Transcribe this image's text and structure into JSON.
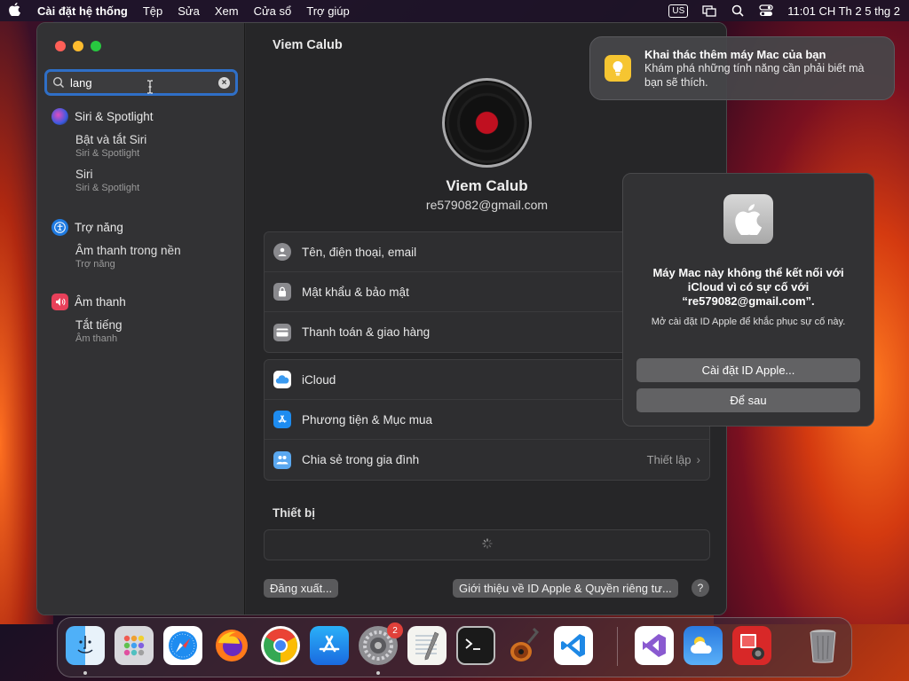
{
  "menubar": {
    "app_name": "Cài đặt hệ thống",
    "items": [
      "Tệp",
      "Sửa",
      "Xem",
      "Cửa sổ",
      "Trợ giúp"
    ],
    "input_source": "US",
    "clock": "11:01 CH Th 2 5 thg 2"
  },
  "sidebar": {
    "search_value": "lang",
    "groups": [
      {
        "title": "Siri & Spotlight",
        "subs": [
          {
            "t": "Bật và tắt Siri",
            "s": "Siri & Spotlight"
          },
          {
            "t": "Siri",
            "s": "Siri & Spotlight"
          }
        ]
      },
      {
        "title": "Trợ năng",
        "subs": [
          {
            "t": "Âm thanh trong nền",
            "s": "Trợ năng"
          }
        ]
      },
      {
        "title": "Âm thanh",
        "subs": [
          {
            "t": "Tắt tiếng",
            "s": "Âm thanh"
          }
        ]
      }
    ]
  },
  "content": {
    "title": "Viem Calub",
    "username": "Viem Calub",
    "email": "re579082@gmail.com",
    "group1": [
      "Tên, điện thoại, email",
      "Mật khẩu & bảo mật",
      "Thanh toán & giao hàng"
    ],
    "group2": [
      {
        "label": "iCloud",
        "right": ""
      },
      {
        "label": "Phương tiện & Mục mua",
        "right": ""
      },
      {
        "label": "Chia sẻ trong gia đình",
        "right": "Thiết lập"
      }
    ],
    "devices_title": "Thiết bị",
    "signout": "Đăng xuất...",
    "about": "Giới thiệu về ID Apple & Quyền riêng tư...",
    "help": "?"
  },
  "notification": {
    "title": "Khai thác thêm máy Mac của bạn",
    "body": "Khám phá những tính năng cần phải biết mà bạn sẽ thích."
  },
  "alert": {
    "title": "Máy Mac này không thể kết nối với iCloud vì có sự cố với “re579082@gmail.com”.",
    "message": "Mở cài đặt ID Apple để khắc phục sự cố này.",
    "primary": "Cài đặt ID Apple...",
    "secondary": "Để sau"
  },
  "dock": {
    "settings_badge": "2",
    "apps": [
      "finder-icon",
      "launchpad-icon",
      "safari-icon",
      "firefox-icon",
      "chrome-icon",
      "app-store-icon",
      "system-settings-icon",
      "textedit-icon",
      "terminal-icon",
      "garageband-icon",
      "vscode-icon",
      "visual-studio-icon",
      "weather-icon",
      "photo-booth-icon",
      "trash-icon"
    ]
  }
}
